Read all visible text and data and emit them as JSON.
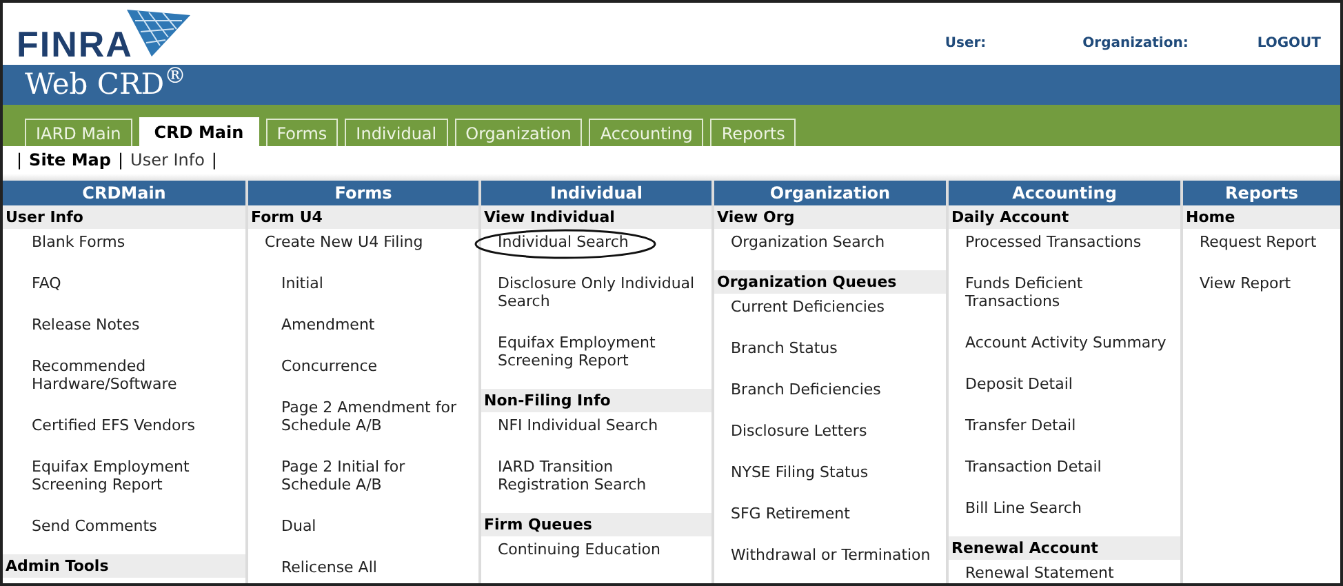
{
  "header": {
    "logo": "FINRA",
    "user_label": "User:",
    "organization_label": "Organization:",
    "logout": "LOGOUT"
  },
  "app_title": "Web CRD$^{®}$",
  "tabs": [
    {
      "label": "IARD Main",
      "selected": false
    },
    {
      "label": "CRD Main",
      "selected": true
    },
    {
      "label": "Forms",
      "selected": false
    },
    {
      "label": "Individual",
      "selected": false
    },
    {
      "label": "Organization",
      "selected": false
    },
    {
      "label": "Accounting",
      "selected": false
    },
    {
      "label": "Reports",
      "selected": false
    }
  ],
  "subnav": [
    {
      "kind": "separator",
      "label": "|"
    },
    {
      "kind": "link",
      "label": "Site Map",
      "selected": true
    },
    {
      "kind": "separator",
      "label": "|"
    },
    {
      "kind": "link",
      "label": "User Info",
      "selected": false
    },
    {
      "kind": "separator",
      "label": "|"
    }
  ],
  "columns": [
    {
      "title": "CRDMain",
      "sections": [
        {
          "heading": "User Info",
          "items": [
            {
              "label": "Blank Forms"
            },
            {
              "label": "FAQ"
            },
            {
              "label": "Release Notes"
            },
            {
              "label": "Recommended Hardware/Software"
            },
            {
              "label": "Certified EFS Vendors"
            },
            {
              "label": "Equifax Employment Screening Report"
            },
            {
              "label": "Send Comments"
            }
          ]
        },
        {
          "heading": "Admin Tools"
        }
      ]
    },
    {
      "title": "Forms",
      "sections": [
        {
          "heading": "Form U4",
          "items": [
            {
              "label": "Create New U4 Filing",
              "children": [
                {
                  "label": "Initial"
                },
                {
                  "label": "Amendment"
                },
                {
                  "label": "Concurrence"
                },
                {
                  "label": "Page 2 Amendment for Schedule A/B"
                },
                {
                  "label": "Page 2 Initial for Schedule A/B"
                },
                {
                  "label": "Dual"
                },
                {
                  "label": "Relicense All"
                }
              ]
            }
          ]
        }
      ]
    },
    {
      "title": "Individual",
      "sections": [
        {
          "heading": "View Individual",
          "items": [
            {
              "label": "Individual Search",
              "circled": true
            },
            {
              "label": "Disclosure Only Individual Search"
            },
            {
              "label": "Equifax Employment Screening Report"
            }
          ]
        },
        {
          "heading": "Non-Filing Info",
          "items": [
            {
              "label": "NFI Individual Search"
            },
            {
              "label": "IARD Transition Registration Search"
            }
          ]
        },
        {
          "heading": "Firm Queues",
          "items": [
            {
              "label": "Continuing Education"
            }
          ]
        }
      ]
    },
    {
      "title": "Organization",
      "sections": [
        {
          "heading": "View Org",
          "items": [
            {
              "label": "Organization Search"
            }
          ]
        },
        {
          "heading": "Organization Queues",
          "items": [
            {
              "label": "Current Deficiencies"
            },
            {
              "label": "Branch Status"
            },
            {
              "label": "Branch Deficiencies"
            },
            {
              "label": "Disclosure Letters"
            },
            {
              "label": "NYSE Filing Status"
            },
            {
              "label": "SFG Retirement"
            },
            {
              "label": "Withdrawal or Termination"
            }
          ]
        }
      ]
    },
    {
      "title": "Accounting",
      "sections": [
        {
          "heading": "Daily Account",
          "items": [
            {
              "label": "Processed Transactions"
            },
            {
              "label": "Funds Deficient Transactions"
            },
            {
              "label": "Account Activity Summary"
            },
            {
              "label": "Deposit Detail"
            },
            {
              "label": "Transfer Detail"
            },
            {
              "label": "Transaction Detail"
            },
            {
              "label": "Bill Line Search"
            }
          ]
        },
        {
          "heading": "Renewal Account",
          "items": [
            {
              "label": "Renewal Statement"
            }
          ]
        }
      ]
    },
    {
      "title": "Reports",
      "sections": [
        {
          "heading": "Home",
          "items": [
            {
              "label": "Request Report"
            },
            {
              "label": "View Report"
            }
          ]
        }
      ]
    }
  ]
}
